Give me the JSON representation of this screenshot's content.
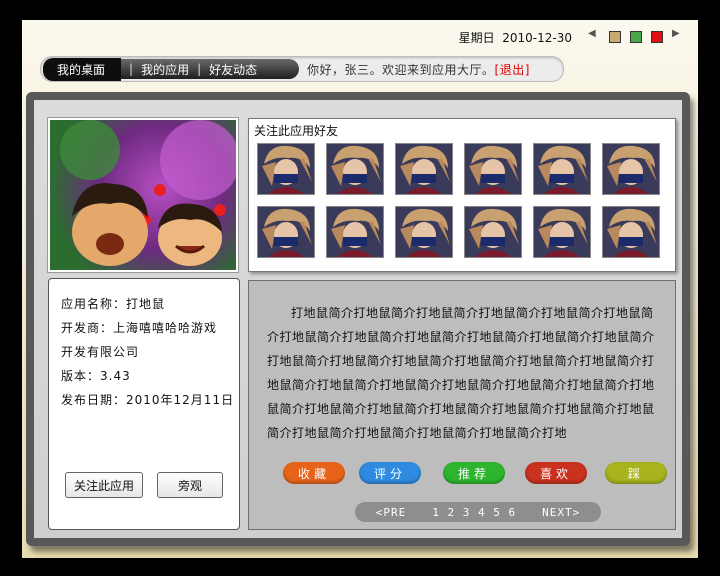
{
  "header": {
    "weekday": "星期日",
    "date": "2010-12-30",
    "themes": [
      "#c8aa70",
      "#4aa84a",
      "#e01010"
    ]
  },
  "nav": {
    "items": [
      "我的桌面",
      "我的应用",
      "好友动态"
    ],
    "welcome": "你好，张三。欢迎来到应用大厅。",
    "logout": "[退出]"
  },
  "friends": {
    "title": "关注此应用好友",
    "count": 12
  },
  "info": {
    "name": "应用名称：打地鼠",
    "developer_line1": "开发商：上海嘻嘻哈哈游戏",
    "developer_line2": "开发有限公司",
    "version": "版本：3.43",
    "release": "发布日期：2010年12月11日",
    "follow_button": "关注此应用",
    "watch_button": "旁观"
  },
  "description": "打地鼠简介打地鼠简介打地鼠简介打地鼠简介打地鼠简介打地鼠简介打地鼠简介打地鼠简介打地鼠简介打地鼠简介打地鼠简介打地鼠简介打地鼠简介打地鼠简介打地鼠简介打地鼠简介打地鼠简介打地鼠简介打地鼠简介打地鼠简介打地鼠简介打地鼠简介打地鼠简介打地鼠简介打地鼠简介打地鼠简介打地鼠简介打地鼠简介打地鼠简介打地鼠简介打地鼠简介打地鼠简介打地鼠简介打地鼠简介打地鼠简介打地",
  "actions": [
    {
      "label": "收藏",
      "color": "#e8631a"
    },
    {
      "label": "评分",
      "color": "#2f8be0"
    },
    {
      "label": "推荐",
      "color": "#2db52d"
    },
    {
      "label": "喜欢",
      "color": "#c9321e"
    },
    {
      "label": "踩",
      "color": "#a8b41e"
    }
  ],
  "pager": {
    "prev": "<PRE",
    "pages": [
      "1",
      "2",
      "3",
      "4",
      "5",
      "6"
    ],
    "next": "NEXT>"
  }
}
